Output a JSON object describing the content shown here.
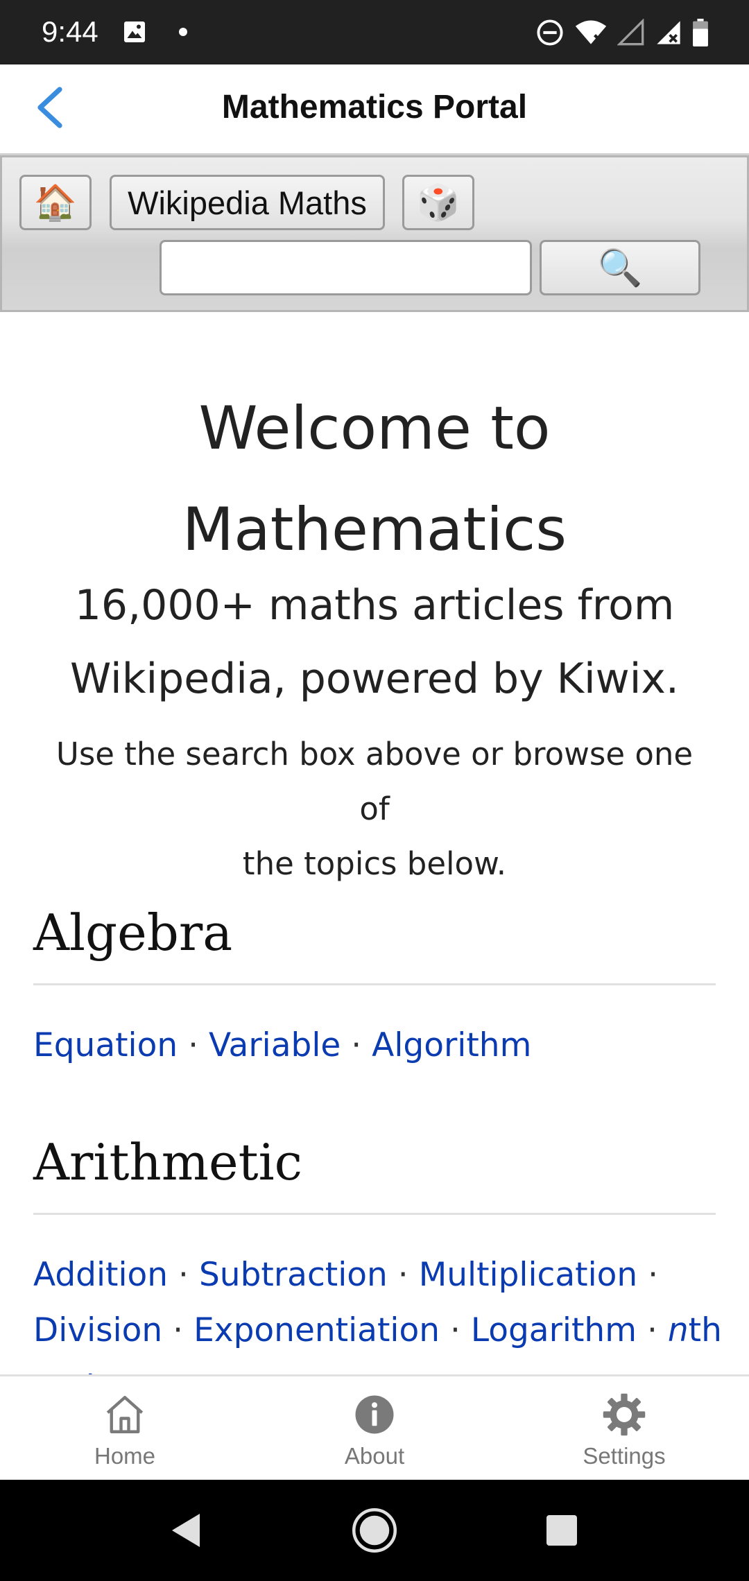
{
  "status_bar": {
    "time": "9:44",
    "left_icons": [
      "image-icon",
      "dot-icon"
    ],
    "right_icons": [
      "do-not-disturb-icon",
      "wifi-icon",
      "signal-empty-icon",
      "signal-icon",
      "battery-icon"
    ]
  },
  "app_bar": {
    "back_icon": "chevron-left-icon",
    "title": "Mathematics Portal"
  },
  "toolbar": {
    "home_icon": "🏠",
    "wiki_label": "Wikipedia Maths",
    "random_icon": "🎲",
    "search_value": "",
    "search_placeholder": "",
    "search_icon": "🔍"
  },
  "welcome": {
    "title_line1": "Welcome to",
    "title_line2": "Mathematics",
    "subtitle_line1": "16,000+ maths articles from",
    "subtitle_line2": "Wikipedia, powered by Kiwix.",
    "help_line1": "Use the search box above or browse one of",
    "help_line2": "the topics below."
  },
  "sections": [
    {
      "heading": "Algebra",
      "links": [
        "Equation",
        "Variable",
        "Algorithm"
      ]
    },
    {
      "heading": "Arithmetic",
      "links": [
        "Addition",
        "Subtraction",
        "Multiplication",
        "Division",
        "Exponentiation",
        "Logarithm",
        "nth root"
      ]
    }
  ],
  "separator": "·",
  "bottom_nav": [
    {
      "label": "Home",
      "icon": "home-outline-icon"
    },
    {
      "label": "About",
      "icon": "info-icon"
    },
    {
      "label": "Settings",
      "icon": "gear-icon"
    }
  ],
  "system_nav": {
    "buttons": [
      "back-triangle-icon",
      "home-circle-icon",
      "recents-square-icon"
    ]
  },
  "colors": {
    "link": "#0b3bb0",
    "accent_back": "#3a8dde",
    "status_bar": "#212121"
  }
}
